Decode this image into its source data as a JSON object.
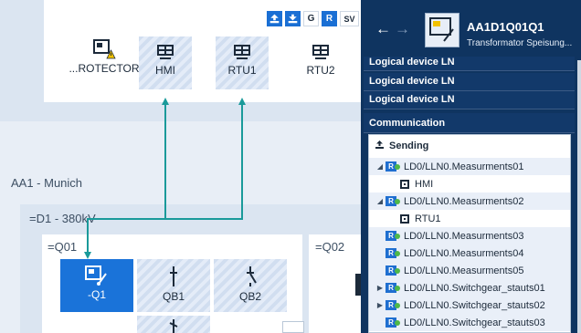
{
  "canvas": {
    "toolbar": {
      "buttons": [
        {
          "label": "",
          "icon": "upload-icon"
        },
        {
          "label": "",
          "icon": "download-icon"
        },
        {
          "label": "G"
        },
        {
          "label": "R"
        },
        {
          "label": "SV"
        }
      ]
    },
    "top_nodes": [
      {
        "label": "...ROTECTOR",
        "icon": "protector-warning-icon"
      },
      {
        "label": "HMI",
        "icon": "network-icon"
      },
      {
        "label": "RTU1",
        "icon": "network-icon"
      },
      {
        "label": "RTU2",
        "icon": "network-icon"
      }
    ],
    "substation_label": "AA1 - Munich",
    "voltage_label": "=D1 - 380kV",
    "bay_q01_label": "=Q01",
    "bay_q02_label": "=Q02",
    "bay_nodes": [
      {
        "label": "-Q1",
        "icon": "ied-device-icon",
        "selected": true
      },
      {
        "label": "QB1",
        "icon": "disconnector-icon"
      },
      {
        "label": "QB2",
        "icon": "disconnector-icon"
      }
    ],
    "colors": {
      "connection": "#1a9a9a",
      "selected": "#1a73d9"
    }
  },
  "panel": {
    "back_icon": "arrow-left-icon",
    "forward_icon": "arrow-right-icon",
    "device_title": "AA1D1Q01Q1",
    "device_subtitle": "Transformator Speisung...",
    "sections": [
      "Logical device LN",
      "Logical device LN",
      "Logical device LN"
    ],
    "communication_label": "Communication",
    "sending_label": "Sending",
    "tree": [
      {
        "label": "LD0/LLN0.Measurments01",
        "expanded": true,
        "children": [
          "HMI"
        ]
      },
      {
        "label": "LD0/LLN0.Measurments02",
        "expanded": true,
        "children": [
          "RTU1"
        ]
      },
      {
        "label": "LD0/LLN0.Measurments03"
      },
      {
        "label": "LD0/LLN0.Measurments04"
      },
      {
        "label": "LD0/LLN0.Measurments05"
      },
      {
        "label": "LD0/LLN0.Switchgear_stauts01",
        "collapsed": true
      },
      {
        "label": "LD0/LLN0.Switchgear_stauts02",
        "collapsed": true
      },
      {
        "label": "LD0/LLN0.Switchgear_stauts03"
      }
    ]
  }
}
